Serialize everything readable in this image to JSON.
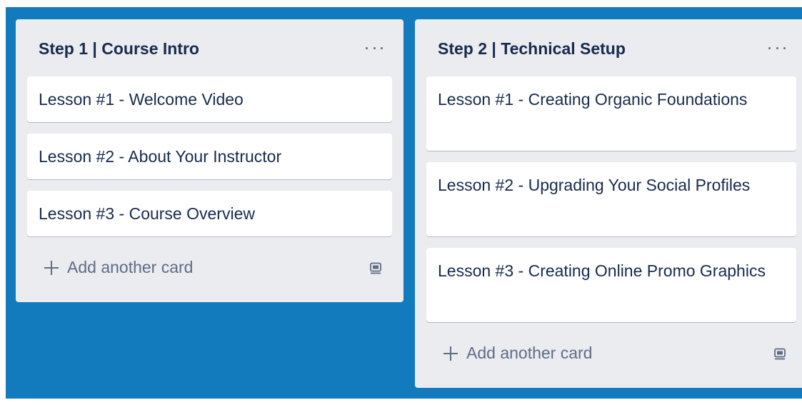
{
  "board": {
    "background_color": "#127bbd",
    "lists": [
      {
        "title": "Step 1 | Course Intro",
        "menu_icon": "more-horizontal-icon",
        "cards": [
          "Lesson #1 - Welcome Video",
          "Lesson #2 - About Your Instructor",
          "Lesson #3 - Course Overview"
        ],
        "add_card_label": "Add another card",
        "template_icon": "card-template-icon"
      },
      {
        "title": "Step 2 | Technical Setup",
        "menu_icon": "more-horizontal-icon",
        "cards": [
          "Lesson #1 - Creating Organic Foundations",
          "Lesson #2 - Upgrading Your Social Profiles",
          "Lesson #3 - Creating Online Promo Graphics"
        ],
        "add_card_label": "Add another card",
        "template_icon": "card-template-icon"
      }
    ]
  },
  "colors": {
    "list_background": "#ebecf0",
    "card_background": "#ffffff",
    "title_text": "#172b4d",
    "muted_text": "#5e6c84"
  }
}
